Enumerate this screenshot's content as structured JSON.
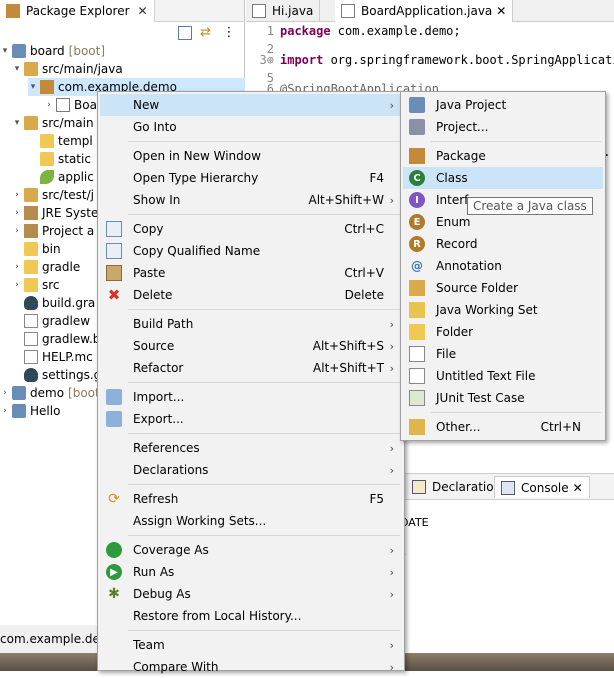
{
  "package_explorer": {
    "tab_label": "Package Explorer",
    "tree": [
      {
        "label": "board",
        "suffix": "[boot]",
        "icon": "project-icon"
      },
      {
        "label": "src/main/java",
        "icon": "source-folder-icon"
      },
      {
        "label": "com.example.demo",
        "icon": "package-icon"
      },
      {
        "label": "Boa",
        "icon": "java-file-icon"
      },
      {
        "label": "src/main",
        "icon": "source-folder-icon"
      },
      {
        "label": "templ",
        "icon": "folder-icon"
      },
      {
        "label": "static",
        "icon": "folder-icon"
      },
      {
        "label": "applic",
        "icon": "leaf-icon"
      },
      {
        "label": "src/test/j",
        "icon": "source-folder-icon"
      },
      {
        "label": "JRE Syste",
        "icon": "library-icon"
      },
      {
        "label": "Project a",
        "icon": "library-icon"
      },
      {
        "label": "bin",
        "icon": "folder-icon"
      },
      {
        "label": "gradle",
        "icon": "folder-icon"
      },
      {
        "label": "src",
        "icon": "folder-icon"
      },
      {
        "label": "build.gra",
        "icon": "gradle-icon"
      },
      {
        "label": "gradlew",
        "icon": "file-icon"
      },
      {
        "label": "gradlew.b",
        "icon": "file-icon"
      },
      {
        "label": "HELP.mc",
        "icon": "file-icon"
      },
      {
        "label": "settings.g",
        "icon": "gradle-icon"
      },
      {
        "label": "demo",
        "suffix": "[boot",
        "icon": "project-icon"
      },
      {
        "label": "Hello",
        "icon": "project-icon"
      }
    ]
  },
  "editor": {
    "tabs": [
      {
        "label": "Hi.java",
        "active": false
      },
      {
        "label": "BoardApplication.java",
        "active": true
      }
    ],
    "lines": [
      {
        "num": "1",
        "kw": "package",
        "text": " com.example.demo;"
      },
      {
        "num": "2",
        "kw": "",
        "text": ""
      },
      {
        "num": "3⊕",
        "kw": "import",
        "text": " org.springframework.boot.SpringApplicati"
      },
      {
        "num": "5",
        "kw": "",
        "text": ""
      },
      {
        "num": "6",
        "kw": "",
        "text": "@SpringBootApplication"
      }
    ],
    "partial_right": "n."
  },
  "console_view": {
    "tabs": [
      {
        "label": "Declaration",
        "active": false
      },
      {
        "label": "Console",
        "active": true
      }
    ],
    "lines": [
      "DATE",
      "s"
    ]
  },
  "status_bar": {
    "text": "com.example.demo"
  },
  "context_menu": {
    "items": [
      {
        "label": "New",
        "shortcut": "",
        "submenu": true,
        "icon": "",
        "highlight": true
      },
      {
        "label": "Go Into",
        "shortcut": "",
        "submenu": false,
        "icon": ""
      },
      {
        "sep": true
      },
      {
        "label": "Open in New Window",
        "shortcut": "",
        "submenu": false,
        "icon": ""
      },
      {
        "label": "Open Type Hierarchy",
        "shortcut": "F4",
        "submenu": false,
        "icon": ""
      },
      {
        "label": "Show In",
        "shortcut": "Alt+Shift+W",
        "submenu": true,
        "icon": ""
      },
      {
        "sep": true
      },
      {
        "label": "Copy",
        "shortcut": "Ctrl+C",
        "submenu": false,
        "icon": "copy-icon"
      },
      {
        "label": "Copy Qualified Name",
        "shortcut": "",
        "submenu": false,
        "icon": "copy-icon"
      },
      {
        "label": "Paste",
        "shortcut": "Ctrl+V",
        "submenu": false,
        "icon": "paste-icon"
      },
      {
        "label": "Delete",
        "shortcut": "Delete",
        "submenu": false,
        "icon": "delete-icon"
      },
      {
        "sep": true
      },
      {
        "label": "Build Path",
        "shortcut": "",
        "submenu": true,
        "icon": ""
      },
      {
        "label": "Source",
        "shortcut": "Alt+Shift+S",
        "submenu": true,
        "icon": ""
      },
      {
        "label": "Refactor",
        "shortcut": "Alt+Shift+T",
        "submenu": true,
        "icon": ""
      },
      {
        "sep": true
      },
      {
        "label": "Import...",
        "shortcut": "",
        "submenu": false,
        "icon": "import-icon"
      },
      {
        "label": "Export...",
        "shortcut": "",
        "submenu": false,
        "icon": "export-icon"
      },
      {
        "sep": true
      },
      {
        "label": "References",
        "shortcut": "",
        "submenu": true,
        "icon": ""
      },
      {
        "label": "Declarations",
        "shortcut": "",
        "submenu": true,
        "icon": ""
      },
      {
        "sep": true
      },
      {
        "label": "Refresh",
        "shortcut": "F5",
        "submenu": false,
        "icon": "refresh-icon"
      },
      {
        "label": "Assign Working Sets...",
        "shortcut": "",
        "submenu": false,
        "icon": ""
      },
      {
        "sep": true
      },
      {
        "label": "Coverage As",
        "shortcut": "",
        "submenu": true,
        "icon": "coverage-icon"
      },
      {
        "label": "Run As",
        "shortcut": "",
        "submenu": true,
        "icon": "run-icon"
      },
      {
        "label": "Debug As",
        "shortcut": "",
        "submenu": true,
        "icon": "debug-icon"
      },
      {
        "label": "Restore from Local History...",
        "shortcut": "",
        "submenu": false,
        "icon": ""
      },
      {
        "sep": true
      },
      {
        "label": "Team",
        "shortcut": "",
        "submenu": true,
        "icon": ""
      },
      {
        "label": "Compare With",
        "shortcut": "",
        "submenu": true,
        "icon": ""
      }
    ]
  },
  "new_submenu": {
    "items": [
      {
        "label": "Java Project",
        "shortcut": "",
        "icon": "java-project-icon"
      },
      {
        "label": "Project...",
        "shortcut": "",
        "icon": "project-wizard-icon"
      },
      {
        "sep": true
      },
      {
        "label": "Package",
        "shortcut": "",
        "icon": "package-icon"
      },
      {
        "label": "Class",
        "shortcut": "",
        "icon": "class-icon",
        "highlight": true
      },
      {
        "label": "Interface",
        "shortcut": "",
        "icon": "interface-icon"
      },
      {
        "label": "Enum",
        "shortcut": "",
        "icon": "enum-icon"
      },
      {
        "label": "Record",
        "shortcut": "",
        "icon": "record-icon"
      },
      {
        "label": "Annotation",
        "shortcut": "",
        "icon": "annotation-icon"
      },
      {
        "label": "Source Folder",
        "shortcut": "",
        "icon": "source-folder-icon"
      },
      {
        "label": "Java Working Set",
        "shortcut": "",
        "icon": "working-set-icon"
      },
      {
        "label": "Folder",
        "shortcut": "",
        "icon": "folder-icon"
      },
      {
        "label": "File",
        "shortcut": "",
        "icon": "file-icon"
      },
      {
        "label": "Untitled Text File",
        "shortcut": "",
        "icon": "text-file-icon"
      },
      {
        "label": "JUnit Test Case",
        "shortcut": "",
        "icon": "junit-icon"
      },
      {
        "sep": true
      },
      {
        "label": "Other...",
        "shortcut": "Ctrl+N",
        "icon": "other-wizard-icon"
      }
    ]
  },
  "tooltip": {
    "text": "Create a Java class"
  }
}
